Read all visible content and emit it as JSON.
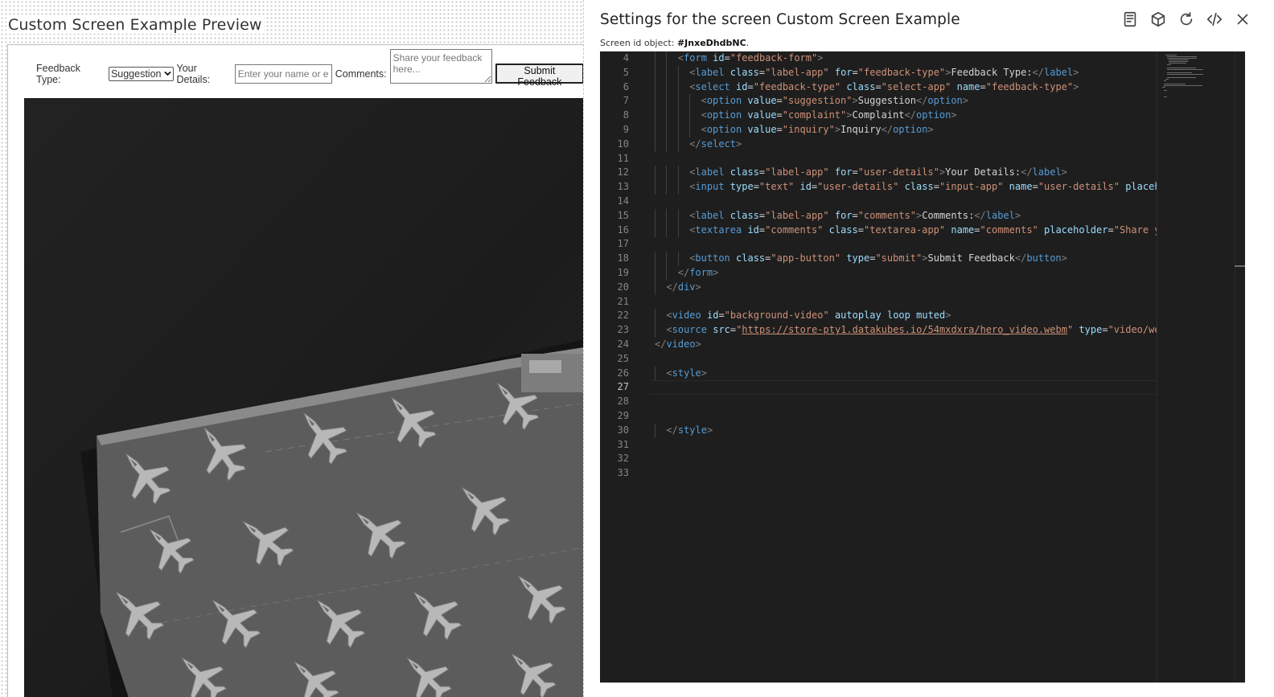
{
  "preview": {
    "title": "Custom Screen Example Preview",
    "form": {
      "feedback_type_label": "Feedback Type:",
      "feedback_type_selected": "Suggestion",
      "user_details_label": "Your Details:",
      "user_details_placeholder": "Enter your name or email",
      "comments_label": "Comments:",
      "comments_placeholder": "Share your feedback here...",
      "submit_label": "Submit Feedback"
    }
  },
  "settings": {
    "title": "Settings for the screen Custom Screen Example",
    "screen_id_prefix": "Screen id object: ",
    "screen_id": "#JnxeDhdbNC",
    "screen_id_suffix": ".",
    "toolbar": [
      "book-icon",
      "cube-icon",
      "refresh-icon",
      "code-icon",
      "close-icon"
    ]
  },
  "editor": {
    "active_line": 27,
    "line_numbers": [
      "4",
      "5",
      "6",
      "7",
      "8",
      "9",
      "10",
      "11",
      "12",
      "13",
      "14",
      "15",
      "16",
      "17",
      "18",
      "19",
      "20",
      "21",
      "22",
      "23",
      "24",
      "25",
      "26",
      "27",
      "28",
      "29",
      "30",
      "31",
      "32",
      "33"
    ],
    "lines": [
      [
        [
          "p",
          "<"
        ],
        [
          "t",
          "form"
        ],
        [
          "x",
          " "
        ],
        [
          "a",
          "id"
        ],
        [
          "x",
          "="
        ],
        [
          "s",
          "\"feedback-form\""
        ],
        [
          "p",
          ">"
        ]
      ],
      [
        [
          "p",
          "<"
        ],
        [
          "t",
          "label"
        ],
        [
          "x",
          " "
        ],
        [
          "a",
          "class"
        ],
        [
          "x",
          "="
        ],
        [
          "s",
          "\"label-app\""
        ],
        [
          "x",
          " "
        ],
        [
          "a",
          "for"
        ],
        [
          "x",
          "="
        ],
        [
          "s",
          "\"feedback-type\""
        ],
        [
          "p",
          ">"
        ],
        [
          "x",
          "Feedback Type:"
        ],
        [
          "p",
          "</"
        ],
        [
          "t",
          "label"
        ],
        [
          "p",
          ">"
        ]
      ],
      [
        [
          "p",
          "<"
        ],
        [
          "t",
          "select"
        ],
        [
          "x",
          " "
        ],
        [
          "a",
          "id"
        ],
        [
          "x",
          "="
        ],
        [
          "s",
          "\"feedback-type\""
        ],
        [
          "x",
          " "
        ],
        [
          "a",
          "class"
        ],
        [
          "x",
          "="
        ],
        [
          "s",
          "\"select-app\""
        ],
        [
          "x",
          " "
        ],
        [
          "a",
          "name"
        ],
        [
          "x",
          "="
        ],
        [
          "s",
          "\"feedback-type\""
        ],
        [
          "p",
          ">"
        ]
      ],
      [
        [
          "p",
          "<"
        ],
        [
          "t",
          "option"
        ],
        [
          "x",
          " "
        ],
        [
          "a",
          "value"
        ],
        [
          "x",
          "="
        ],
        [
          "s",
          "\"suggestion\""
        ],
        [
          "p",
          ">"
        ],
        [
          "x",
          "Suggestion"
        ],
        [
          "p",
          "</"
        ],
        [
          "t",
          "option"
        ],
        [
          "p",
          ">"
        ]
      ],
      [
        [
          "p",
          "<"
        ],
        [
          "t",
          "option"
        ],
        [
          "x",
          " "
        ],
        [
          "a",
          "value"
        ],
        [
          "x",
          "="
        ],
        [
          "s",
          "\"complaint\""
        ],
        [
          "p",
          ">"
        ],
        [
          "x",
          "Complaint"
        ],
        [
          "p",
          "</"
        ],
        [
          "t",
          "option"
        ],
        [
          "p",
          ">"
        ]
      ],
      [
        [
          "p",
          "<"
        ],
        [
          "t",
          "option"
        ],
        [
          "x",
          " "
        ],
        [
          "a",
          "value"
        ],
        [
          "x",
          "="
        ],
        [
          "s",
          "\"inquiry\""
        ],
        [
          "p",
          ">"
        ],
        [
          "x",
          "Inquiry"
        ],
        [
          "p",
          "</"
        ],
        [
          "t",
          "option"
        ],
        [
          "p",
          ">"
        ]
      ],
      [
        [
          "p",
          "</"
        ],
        [
          "t",
          "select"
        ],
        [
          "p",
          ">"
        ]
      ],
      [],
      [
        [
          "p",
          "<"
        ],
        [
          "t",
          "label"
        ],
        [
          "x",
          " "
        ],
        [
          "a",
          "class"
        ],
        [
          "x",
          "="
        ],
        [
          "s",
          "\"label-app\""
        ],
        [
          "x",
          " "
        ],
        [
          "a",
          "for"
        ],
        [
          "x",
          "="
        ],
        [
          "s",
          "\"user-details\""
        ],
        [
          "p",
          ">"
        ],
        [
          "x",
          "Your Details:"
        ],
        [
          "p",
          "</"
        ],
        [
          "t",
          "label"
        ],
        [
          "p",
          ">"
        ]
      ],
      [
        [
          "p",
          "<"
        ],
        [
          "t",
          "input"
        ],
        [
          "x",
          " "
        ],
        [
          "a",
          "type"
        ],
        [
          "x",
          "="
        ],
        [
          "s",
          "\"text\""
        ],
        [
          "x",
          " "
        ],
        [
          "a",
          "id"
        ],
        [
          "x",
          "="
        ],
        [
          "s",
          "\"user-details\""
        ],
        [
          "x",
          " "
        ],
        [
          "a",
          "class"
        ],
        [
          "x",
          "="
        ],
        [
          "s",
          "\"input-app\""
        ],
        [
          "x",
          " "
        ],
        [
          "a",
          "name"
        ],
        [
          "x",
          "="
        ],
        [
          "s",
          "\"user-details\""
        ],
        [
          "x",
          " "
        ],
        [
          "a",
          "placeho"
        ]
      ],
      [],
      [
        [
          "p",
          "<"
        ],
        [
          "t",
          "label"
        ],
        [
          "x",
          " "
        ],
        [
          "a",
          "class"
        ],
        [
          "x",
          "="
        ],
        [
          "s",
          "\"label-app\""
        ],
        [
          "x",
          " "
        ],
        [
          "a",
          "for"
        ],
        [
          "x",
          "="
        ],
        [
          "s",
          "\"comments\""
        ],
        [
          "p",
          ">"
        ],
        [
          "x",
          "Comments:"
        ],
        [
          "p",
          "</"
        ],
        [
          "t",
          "label"
        ],
        [
          "p",
          ">"
        ]
      ],
      [
        [
          "p",
          "<"
        ],
        [
          "t",
          "textarea"
        ],
        [
          "x",
          " "
        ],
        [
          "a",
          "id"
        ],
        [
          "x",
          "="
        ],
        [
          "s",
          "\"comments\""
        ],
        [
          "x",
          " "
        ],
        [
          "a",
          "class"
        ],
        [
          "x",
          "="
        ],
        [
          "s",
          "\"textarea-app\""
        ],
        [
          "x",
          " "
        ],
        [
          "a",
          "name"
        ],
        [
          "x",
          "="
        ],
        [
          "s",
          "\"comments\""
        ],
        [
          "x",
          " "
        ],
        [
          "a",
          "placeholder"
        ],
        [
          "x",
          "="
        ],
        [
          "s",
          "\"Share yo"
        ]
      ],
      [],
      [
        [
          "p",
          "<"
        ],
        [
          "t",
          "button"
        ],
        [
          "x",
          " "
        ],
        [
          "a",
          "class"
        ],
        [
          "x",
          "="
        ],
        [
          "s",
          "\"app-button\""
        ],
        [
          "x",
          " "
        ],
        [
          "a",
          "type"
        ],
        [
          "x",
          "="
        ],
        [
          "s",
          "\"submit\""
        ],
        [
          "p",
          ">"
        ],
        [
          "x",
          "Submit Feedback"
        ],
        [
          "p",
          "</"
        ],
        [
          "t",
          "button"
        ],
        [
          "p",
          ">"
        ]
      ],
      [
        [
          "p",
          "</"
        ],
        [
          "t",
          "form"
        ],
        [
          "p",
          ">"
        ]
      ],
      [
        [
          "p",
          "</"
        ],
        [
          "t",
          "div"
        ],
        [
          "p",
          ">"
        ]
      ],
      [],
      [
        [
          "p",
          "<"
        ],
        [
          "t",
          "video"
        ],
        [
          "x",
          " "
        ],
        [
          "a",
          "id"
        ],
        [
          "x",
          "="
        ],
        [
          "s",
          "\"background-video\""
        ],
        [
          "x",
          " "
        ],
        [
          "a",
          "autoplay"
        ],
        [
          "x",
          " "
        ],
        [
          "a",
          "loop"
        ],
        [
          "x",
          " "
        ],
        [
          "a",
          "muted"
        ],
        [
          "p",
          ">"
        ]
      ],
      [
        [
          "p",
          "<"
        ],
        [
          "t",
          "source"
        ],
        [
          "x",
          " "
        ],
        [
          "a",
          "src"
        ],
        [
          "x",
          "="
        ],
        [
          "s",
          "\""
        ],
        [
          "u",
          "https://store-pty1.datakubes.io/54mxdxra/hero_video.webm"
        ],
        [
          "s",
          "\""
        ],
        [
          "x",
          " "
        ],
        [
          "a",
          "type"
        ],
        [
          "x",
          "="
        ],
        [
          "s",
          "\"video/webm"
        ]
      ],
      [
        [
          "p",
          "</"
        ],
        [
          "t",
          "video"
        ],
        [
          "p",
          ">"
        ]
      ],
      [],
      [
        [
          "p",
          "<"
        ],
        [
          "t",
          "style"
        ],
        [
          "p",
          ">"
        ]
      ],
      [],
      [],
      [],
      [
        [
          "p",
          "</"
        ],
        [
          "t",
          "style"
        ],
        [
          "p",
          ">"
        ]
      ],
      [],
      [],
      []
    ]
  },
  "colors": {
    "editor_bg": "#1e1e1e",
    "tag": "#569cd6",
    "attr": "#9cdcfe",
    "string": "#ce9178",
    "punct": "#808080",
    "text": "#d4d4d4"
  }
}
